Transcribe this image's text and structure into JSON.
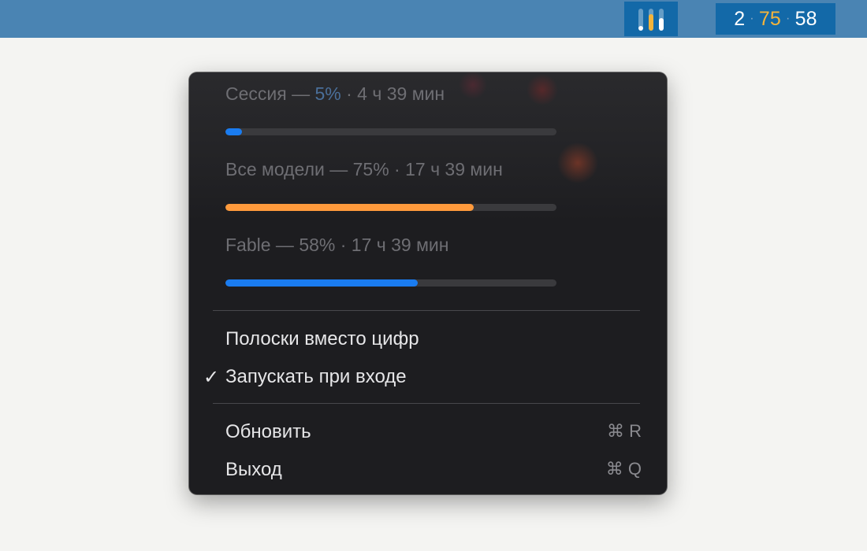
{
  "menubar": {
    "bars_icon": {
      "name": "usage-bars-icon",
      "levels": [
        0.05,
        0.75,
        0.58
      ],
      "colors": [
        "#ffffff",
        "#f5b43a",
        "#ffffff"
      ]
    },
    "numbers": {
      "first": "2",
      "second": "75",
      "third": "58",
      "separator": "·",
      "second_color": "#f5b43a"
    }
  },
  "popup": {
    "usage": [
      {
        "label_prefix": "Сессия — ",
        "percent_text": "5%",
        "label_suffix": " · 4 ч 39 мин",
        "fraction": 0.05,
        "color": "#1a7cf0"
      },
      {
        "label": "Все модели — 75% · 17 ч 39 мин",
        "fraction": 0.75,
        "color": "#ff9a3c"
      },
      {
        "label": "Fable — 58% · 17 ч 39 мин",
        "fraction": 0.58,
        "color": "#1a7cf0"
      }
    ],
    "options": {
      "bars_instead_of_numbers": "Полоски вместо цифр",
      "launch_at_login": "Запускать при входе",
      "launch_at_login_checked": true,
      "check_glyph": "✓"
    },
    "actions": {
      "refresh": "Обновить",
      "refresh_shortcut": "⌘ R",
      "quit": "Выход",
      "quit_shortcut": "⌘ Q"
    }
  }
}
